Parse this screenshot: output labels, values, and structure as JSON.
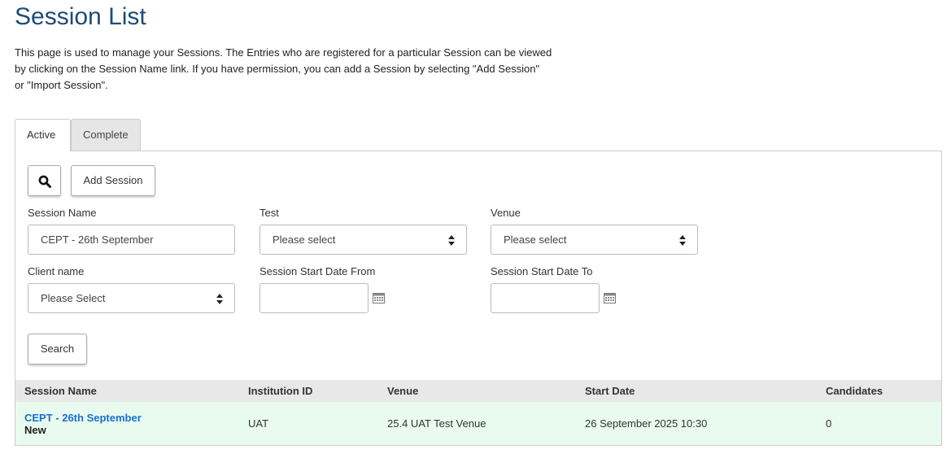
{
  "page": {
    "title": "Session List",
    "intro_line1": "This page is used to manage your Sessions. The Entries who are registered for a particular Session can be viewed",
    "intro_line2": "by clicking on the Session Name link. If you have permission, you can add a Session by selecting \"Add Session\"",
    "intro_line3": "or \"Import Session\"."
  },
  "tabs": [
    {
      "label": "Active",
      "active": true
    },
    {
      "label": "Complete",
      "active": false
    }
  ],
  "toolbar": {
    "search_icon": "magnifier-icon",
    "add_session_label": "Add Session"
  },
  "filters": {
    "session_name_label": "Session Name",
    "session_name_value": "CEPT - 26th September",
    "test_label": "Test",
    "test_value": "Please select",
    "venue_label": "Venue",
    "venue_value": "Please select",
    "client_label": "Client name",
    "client_value": "Please Select",
    "start_from_label": "Session Start Date From",
    "start_from_value": "",
    "start_to_label": "Session Start Date To",
    "start_to_value": "",
    "calendar_icon": "calendar-icon",
    "search_button_label": "Search"
  },
  "table": {
    "columns": [
      "Session Name",
      "Institution ID",
      "Venue",
      "Start Date",
      "Candidates"
    ],
    "rows": [
      {
        "session_name": "CEPT - 26th September",
        "status": "New",
        "institution_id": "UAT",
        "venue": "25.4 UAT Test Venue",
        "start_date": "26 September 2025 10:30",
        "candidates": "0"
      }
    ]
  },
  "colors": {
    "title": "#1e4b75",
    "link": "#1a6fd1",
    "row_bg": "#e9fbef",
    "header_bg": "#e8e8e8"
  }
}
